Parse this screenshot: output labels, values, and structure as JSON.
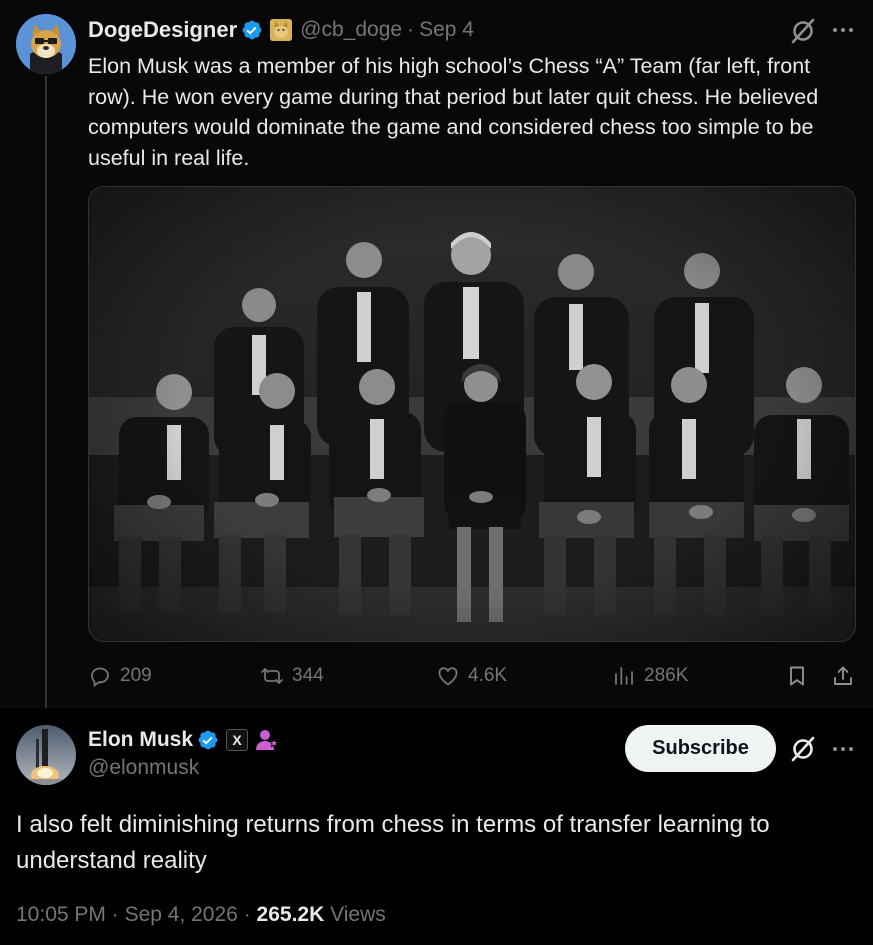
{
  "quoted_tweet": {
    "author_name": "DogeDesigner",
    "handle": "@cb_doge",
    "separator": "·",
    "date": "Sep 4",
    "text": "Elon Musk was a member of his high school’s Chess “A” Team (far left, front row). He won every game during that period but later quit chess. He believed computers would dominate the game and considered chess too simple to be useful in real life.",
    "stats": {
      "replies": "209",
      "reposts": "344",
      "likes": "4.6K",
      "views": "286K"
    }
  },
  "tweet": {
    "author_name": "Elon Musk",
    "handle": "@elonmusk",
    "badge_x": "X",
    "subscribe_label": "Subscribe",
    "text": "I also felt diminishing returns from chess in terms of transfer learning to understand reality",
    "time": "10:05 PM",
    "separator": "·",
    "date": "Sep 4, 2026",
    "views_count": "265.2K",
    "views_label": "Views"
  },
  "colors": {
    "background": "#000000",
    "text_primary": "#e7e9ea",
    "text_secondary": "#71767b",
    "verified": "#1d9bf0",
    "affiliate": "#c95fd0"
  },
  "icons": [
    "verified-badge-icon",
    "doge-badge-icon",
    "grok-icon",
    "more-icon",
    "reply-icon",
    "repost-icon",
    "like-icon",
    "views-icon",
    "bookmark-icon",
    "share-icon",
    "x-badge-icon",
    "affiliate-badge-icon"
  ]
}
